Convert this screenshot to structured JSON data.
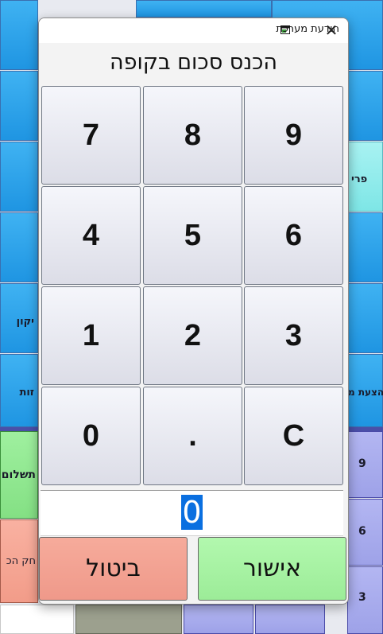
{
  "background": {
    "right_labels": [
      "פרי",
      "9",
      "6",
      "3"
    ],
    "left_labels": [
      "יקון",
      "זות",
      "תשלום",
      "חק הכ"
    ],
    "partial_label": "הצעת מ"
  },
  "dialog": {
    "title": "הודעת מערכת",
    "close_glyph": "✕",
    "prompt": "הכנס סכום בקופה",
    "keypad": [
      [
        "7",
        "8",
        "9"
      ],
      [
        "4",
        "5",
        "6"
      ],
      [
        "1",
        "2",
        "3"
      ],
      [
        "0",
        ".",
        "C"
      ]
    ],
    "display_value": "0",
    "cancel_label": "ביטול",
    "confirm_label": "אישור"
  },
  "colors": {
    "tile_blue": "#28a0ea",
    "tile_teal": "#8fecec",
    "tile_green": "#90e890",
    "tile_salmon": "#f4a493",
    "tile_lavender": "#a6aaec",
    "selection": "#0a6fe0"
  }
}
